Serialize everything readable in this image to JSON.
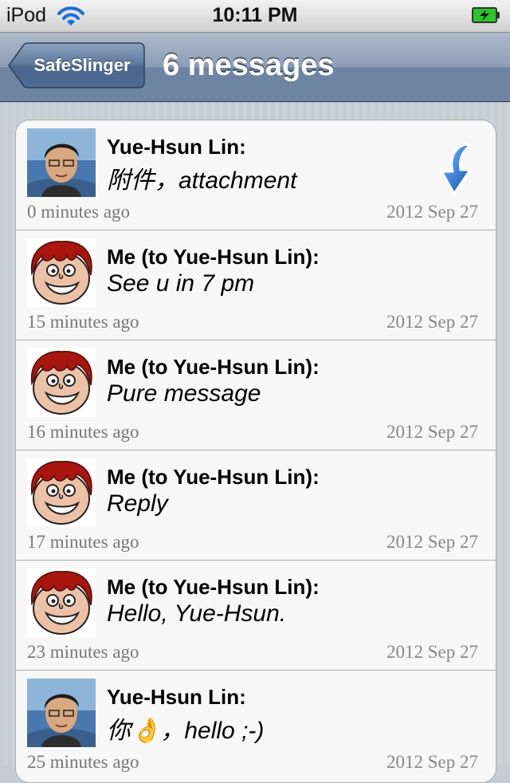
{
  "status": {
    "carrier": "iPod",
    "time": "10:11 PM"
  },
  "nav": {
    "back_label": "SafeSlinger",
    "title": "6 messages"
  },
  "colors": {
    "nav_blue": "#6d84a2",
    "arrow_blue": "#1e6fd8",
    "battery_green": "#2ec52a"
  },
  "messages": [
    {
      "sender": "Yue-Hsun Lin:",
      "body": "附件，attachment",
      "ago": "0 minutes ago",
      "date": "2012 Sep 27",
      "avatar": "photo-avatar",
      "attachment": "download-arrow-icon"
    },
    {
      "sender": "Me (to Yue-Hsun Lin):",
      "body": "See u in 7 pm",
      "ago": "15 minutes ago",
      "date": "2012 Sep 27",
      "avatar": "cartoon-avatar"
    },
    {
      "sender": "Me (to Yue-Hsun Lin):",
      "body": "Pure message",
      "ago": "16 minutes ago",
      "date": "2012 Sep 27",
      "avatar": "cartoon-avatar"
    },
    {
      "sender": "Me (to Yue-Hsun Lin):",
      "body": "Reply",
      "ago": "17 minutes ago",
      "date": "2012 Sep 27",
      "avatar": "cartoon-avatar"
    },
    {
      "sender": "Me (to Yue-Hsun Lin):",
      "body": "Hello, Yue-Hsun.",
      "ago": "23 minutes ago",
      "date": "2012 Sep 27",
      "avatar": "cartoon-avatar"
    },
    {
      "sender": "Yue-Hsun Lin:",
      "body": "你👌，hello ;-)",
      "ago": "25 minutes ago",
      "date": "2012 Sep 27",
      "avatar": "photo-avatar"
    }
  ]
}
